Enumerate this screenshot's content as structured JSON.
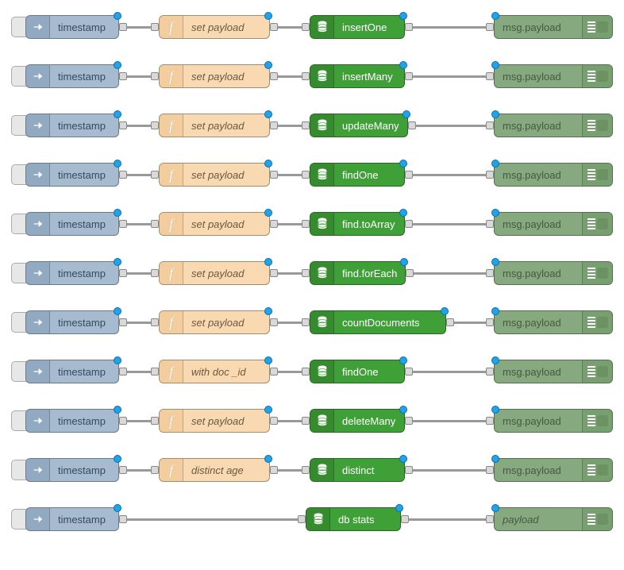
{
  "flows": [
    {
      "inject": "timestamp",
      "func": "set payload",
      "mongo": "insertOne",
      "mongo_wide": false,
      "debug": "msg.payload",
      "debug_italic": false,
      "has_func": true
    },
    {
      "inject": "timestamp",
      "func": "set payload",
      "mongo": "insertMany",
      "mongo_wide": false,
      "debug": "msg.payload",
      "debug_italic": false,
      "has_func": true
    },
    {
      "inject": "timestamp",
      "func": "set payload",
      "mongo": "updateMany",
      "mongo_wide": false,
      "debug": "msg.payload",
      "debug_italic": false,
      "has_func": true
    },
    {
      "inject": "timestamp",
      "func": "set payload",
      "mongo": "findOne",
      "mongo_wide": false,
      "debug": "msg.payload",
      "debug_italic": false,
      "has_func": true
    },
    {
      "inject": "timestamp",
      "func": "set payload",
      "mongo": "find.toArray",
      "mongo_wide": false,
      "debug": "msg.payload",
      "debug_italic": false,
      "has_func": true
    },
    {
      "inject": "timestamp",
      "func": "set payload",
      "mongo": "find.forEach",
      "mongo_wide": false,
      "debug": "msg.payload",
      "debug_italic": false,
      "has_func": true
    },
    {
      "inject": "timestamp",
      "func": "set payload",
      "mongo": "countDocuments",
      "mongo_wide": true,
      "debug": "msg.payload",
      "debug_italic": false,
      "has_func": true
    },
    {
      "inject": "timestamp",
      "func": "with doc _id",
      "mongo": "findOne",
      "mongo_wide": false,
      "debug": "msg.payload",
      "debug_italic": false,
      "has_func": true
    },
    {
      "inject": "timestamp",
      "func": "set payload",
      "mongo": "deleteMany",
      "mongo_wide": false,
      "debug": "msg.payload",
      "debug_italic": false,
      "has_func": true
    },
    {
      "inject": "timestamp",
      "func": "distinct age",
      "mongo": "distinct",
      "mongo_wide": false,
      "debug": "msg.payload",
      "debug_italic": false,
      "has_func": true
    },
    {
      "inject": "timestamp",
      "func": "",
      "mongo": "db stats",
      "mongo_wide": false,
      "debug": "payload",
      "debug_italic": true,
      "has_func": false
    }
  ]
}
